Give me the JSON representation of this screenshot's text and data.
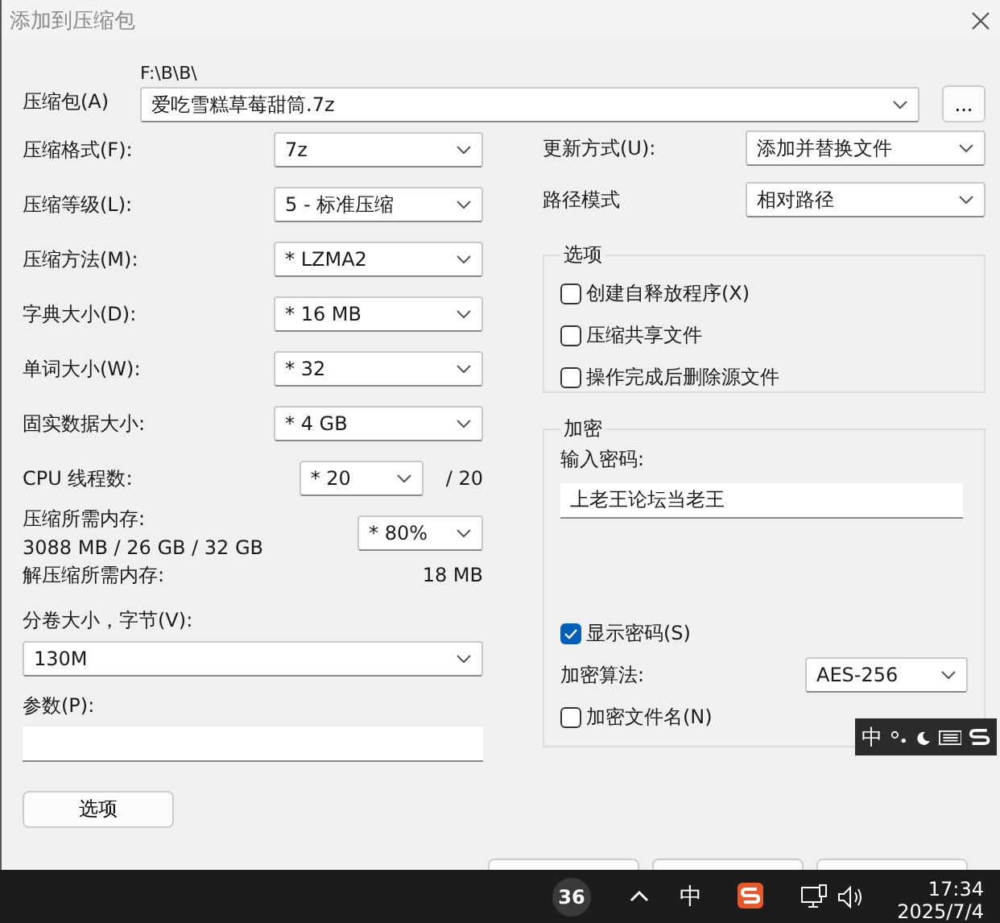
{
  "window": {
    "title": "添加到压缩包"
  },
  "archive": {
    "label": "压缩包(A)",
    "path": "F:\\B\\B\\",
    "value": "爱吃雪糕草莓甜筒.7z",
    "browse": "..."
  },
  "left_fields": [
    {
      "kind": "combo",
      "label": "压缩格式(F):",
      "value": "7z"
    },
    {
      "kind": "combo",
      "label": "压缩等级(L):",
      "value": "5 - 标准压缩"
    },
    {
      "kind": "combo",
      "label": "压缩方法(M):",
      "value": "* LZMA2"
    },
    {
      "kind": "combo",
      "label": "字典大小(D):",
      "value": "* 16 MB"
    },
    {
      "kind": "combo",
      "label": "单词大小(W):",
      "value": "* 32"
    },
    {
      "kind": "combo",
      "label": "固实数据大小:",
      "value": "* 4 GB"
    },
    {
      "kind": "threads",
      "label": "CPU 线程数:",
      "value": "* 20",
      "suffix": "/ 20"
    },
    {
      "kind": "memory",
      "label": "压缩所需内存:",
      "detail": "3088 MB / 26 GB / 32 GB",
      "value": "* 80%"
    },
    {
      "kind": "info",
      "label": "解压缩所需内存:",
      "value": "18 MB"
    }
  ],
  "volume": {
    "label": "分卷大小，字节(V):",
    "value": "130M"
  },
  "params": {
    "label": "参数(P):"
  },
  "options_button": "选项",
  "right_fields": [
    {
      "label": "更新方式(U):",
      "value": "添加并替换文件"
    },
    {
      "label": "路径模式",
      "value": "相对路径"
    }
  ],
  "options_group": {
    "title": "选项",
    "items": [
      {
        "label": "创建自释放程序(X)",
        "checked": false
      },
      {
        "label": "压缩共享文件",
        "checked": false
      },
      {
        "label": "操作完成后删除源文件",
        "checked": false
      }
    ]
  },
  "encryption": {
    "title": "加密",
    "password_label": "输入密码:",
    "password": "上老王论坛当老王",
    "show_password": {
      "label": "显示密码(S)",
      "checked": true
    },
    "method_label": "加密算法:",
    "method": "AES-256",
    "encrypt_names": {
      "label": "加密文件名(N)",
      "checked": false
    }
  },
  "ime_toolbar": {
    "mode": "中"
  },
  "taskbar": {
    "badge": "36",
    "ime": "中",
    "time": "17:34",
    "date": "2025/7/4"
  }
}
